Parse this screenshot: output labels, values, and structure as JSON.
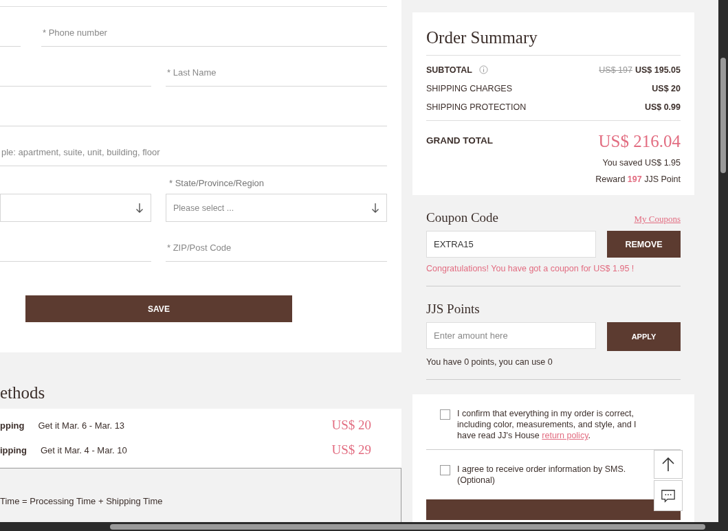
{
  "address_form": {
    "rows": [
      {
        "fields": [
          {
            "kind": "text"
          },
          {
            "kind": "text",
            "placeholder": "* Phone number"
          }
        ]
      },
      {
        "fields": [
          {
            "kind": "text"
          },
          {
            "kind": "text",
            "placeholder": "* Last Name"
          }
        ]
      },
      {
        "fields": [
          {
            "kind": "text"
          }
        ]
      },
      {
        "fields": [
          {
            "kind": "text",
            "placeholder": "ple: apartment, suite, unit, building, floor"
          }
        ]
      },
      {
        "fields": [
          {
            "kind": "select"
          },
          {
            "kind": "select",
            "label": "* State/Province/Region",
            "placeholder": "Please select ..."
          }
        ]
      },
      {
        "fields": [
          {
            "kind": "text"
          },
          {
            "kind": "text",
            "placeholder": "* ZIP/Post Code"
          }
        ]
      }
    ],
    "save_button": "SAVE"
  },
  "shipping_methods": {
    "title": "ethods",
    "options": [
      {
        "name": "pping",
        "estimate": "Get it Mar. 6 - Mar. 13",
        "price": "US$ 20"
      },
      {
        "name": "ipping",
        "estimate": "Get it Mar. 4 - Mar. 10",
        "price": "US$ 29"
      }
    ],
    "note": "Time = Processing Time + Shipping Time"
  },
  "order_summary": {
    "title": "Order Summary",
    "lines": [
      {
        "label": "SUBTOTAL",
        "bold": true,
        "info": true,
        "old_price": "US$ 197",
        "value": "US$ 195.05"
      },
      {
        "label": "SHIPPING CHARGES",
        "bold": false,
        "info": false,
        "value": "US$ 20"
      },
      {
        "label": "SHIPPING PROTECTION",
        "bold": false,
        "info": false,
        "value": "US$ 0.99"
      }
    ],
    "grand_total": {
      "label": "GRAND TOTAL",
      "value": "US$ 216.04"
    },
    "saved": "You saved US$ 1.95",
    "reward": {
      "before": "Reward",
      "points": "197",
      "after": "JJS Point"
    }
  },
  "coupon": {
    "title": "Coupon Code",
    "link": "My Coupons",
    "value": "EXTRA15",
    "button": "REMOVE",
    "message": "Congratulations! You have got a coupon for US$ 1.95 !"
  },
  "points": {
    "title": "JJS Points",
    "placeholder": "Enter amount here",
    "button": "APPLY",
    "note": "You have 0 points, you can use 0"
  },
  "agreements": [
    {
      "text": "I confirm that everything in my order is correct, including color, measurements, and style, and I have read JJ's House ",
      "link": "return policy",
      "after": ".",
      "checked": false
    },
    {
      "text": "I agree to receive order information by SMS. (Optional)",
      "checked": false
    }
  ]
}
